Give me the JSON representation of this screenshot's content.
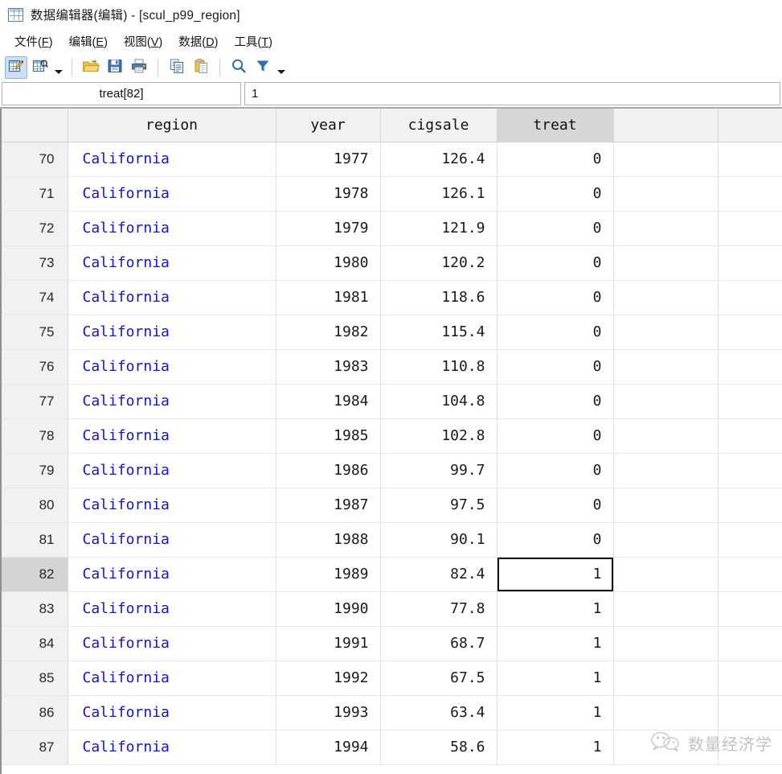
{
  "window": {
    "icon": "data-editor-icon",
    "title": "数据编辑器(编辑) - [scul_p99_region]"
  },
  "menubar": {
    "items": [
      {
        "name": "file",
        "label": "文件(F)",
        "text": "文件(",
        "accel": "F",
        "tail": ")"
      },
      {
        "name": "edit",
        "label": "编辑(E)",
        "text": "编辑(",
        "accel": "E",
        "tail": ")"
      },
      {
        "name": "view",
        "label": "视图(V)",
        "text": "视图(",
        "accel": "V",
        "tail": ")"
      },
      {
        "name": "data",
        "label": "数据(D)",
        "text": "数据(",
        "accel": "D",
        "tail": ")"
      },
      {
        "name": "tools",
        "label": "工具(T)",
        "text": "工具(",
        "accel": "T",
        "tail": ")"
      }
    ]
  },
  "toolbar": {
    "buttons": [
      {
        "name": "edit-mode-icon",
        "active": true
      },
      {
        "name": "browse-mode-icon",
        "active": false
      },
      {
        "name": "open-folder-icon",
        "active": false
      },
      {
        "name": "save-icon",
        "active": false
      },
      {
        "name": "print-icon",
        "active": false
      },
      {
        "name": "copy-icon",
        "active": false
      },
      {
        "name": "paste-icon",
        "active": false
      },
      {
        "name": "search-icon",
        "active": false
      },
      {
        "name": "filter-icon",
        "active": false
      }
    ]
  },
  "cellbar": {
    "reference": "treat[82]",
    "value": "1"
  },
  "grid": {
    "columns": [
      "",
      "region",
      "year",
      "cigsale",
      "treat",
      "",
      ""
    ],
    "selected_column": "treat",
    "selected_row": "82",
    "active_cell": {
      "row": "82",
      "column": "treat",
      "value": "1"
    },
    "rows": [
      {
        "num": "70",
        "region": "California",
        "year": "1977",
        "cigsale": "126.4",
        "treat": "0"
      },
      {
        "num": "71",
        "region": "California",
        "year": "1978",
        "cigsale": "126.1",
        "treat": "0"
      },
      {
        "num": "72",
        "region": "California",
        "year": "1979",
        "cigsale": "121.9",
        "treat": "0"
      },
      {
        "num": "73",
        "region": "California",
        "year": "1980",
        "cigsale": "120.2",
        "treat": "0"
      },
      {
        "num": "74",
        "region": "California",
        "year": "1981",
        "cigsale": "118.6",
        "treat": "0"
      },
      {
        "num": "75",
        "region": "California",
        "year": "1982",
        "cigsale": "115.4",
        "treat": "0"
      },
      {
        "num": "76",
        "region": "California",
        "year": "1983",
        "cigsale": "110.8",
        "treat": "0"
      },
      {
        "num": "77",
        "region": "California",
        "year": "1984",
        "cigsale": "104.8",
        "treat": "0"
      },
      {
        "num": "78",
        "region": "California",
        "year": "1985",
        "cigsale": "102.8",
        "treat": "0"
      },
      {
        "num": "79",
        "region": "California",
        "year": "1986",
        "cigsale": "99.7",
        "treat": "0"
      },
      {
        "num": "80",
        "region": "California",
        "year": "1987",
        "cigsale": "97.5",
        "treat": "0"
      },
      {
        "num": "81",
        "region": "California",
        "year": "1988",
        "cigsale": "90.1",
        "treat": "0"
      },
      {
        "num": "82",
        "region": "California",
        "year": "1989",
        "cigsale": "82.4",
        "treat": "1"
      },
      {
        "num": "83",
        "region": "California",
        "year": "1990",
        "cigsale": "77.8",
        "treat": "1"
      },
      {
        "num": "84",
        "region": "California",
        "year": "1991",
        "cigsale": "68.7",
        "treat": "1"
      },
      {
        "num": "85",
        "region": "California",
        "year": "1992",
        "cigsale": "67.5",
        "treat": "1"
      },
      {
        "num": "86",
        "region": "California",
        "year": "1993",
        "cigsale": "63.4",
        "treat": "1"
      },
      {
        "num": "87",
        "region": "California",
        "year": "1994",
        "cigsale": "58.6",
        "treat": "1"
      }
    ]
  },
  "watermark": {
    "icon": "wechat-icon",
    "text": "数量经济学"
  },
  "colors": {
    "string_value": "#1414c8",
    "selected_header": "#d6d6d6",
    "selected_rownum": "#d4d4d4",
    "header_bg": "#f1f1f1",
    "toolbar_active": "#cce0f5"
  }
}
